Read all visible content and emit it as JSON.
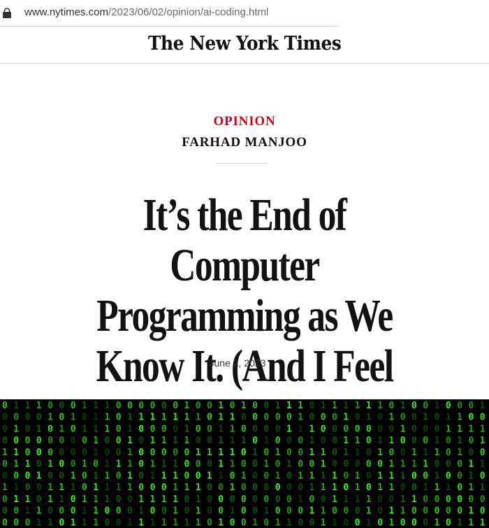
{
  "browser": {
    "url_host": "www.nytimes.com",
    "url_path": "/2023/06/02/opinion/ai-coding.html"
  },
  "masthead": {
    "logo_text": "The New York Times"
  },
  "article": {
    "section": "OPINION",
    "author": "FARHAD MANJOO",
    "headline_lines": [
      "It’s the End of Computer",
      "Programming as We",
      "Know It. (And I Feel Fine.)"
    ],
    "date": "June 2, 2023"
  },
  "hero_image": {
    "description_icon": "binary-matrix-image",
    "colors": {
      "background": "#000000",
      "digits_bright": "#39ff14",
      "digits_dim": "#0f6b12"
    }
  },
  "colors": {
    "opinion_red": "#d0021b",
    "text": "#121212"
  }
}
